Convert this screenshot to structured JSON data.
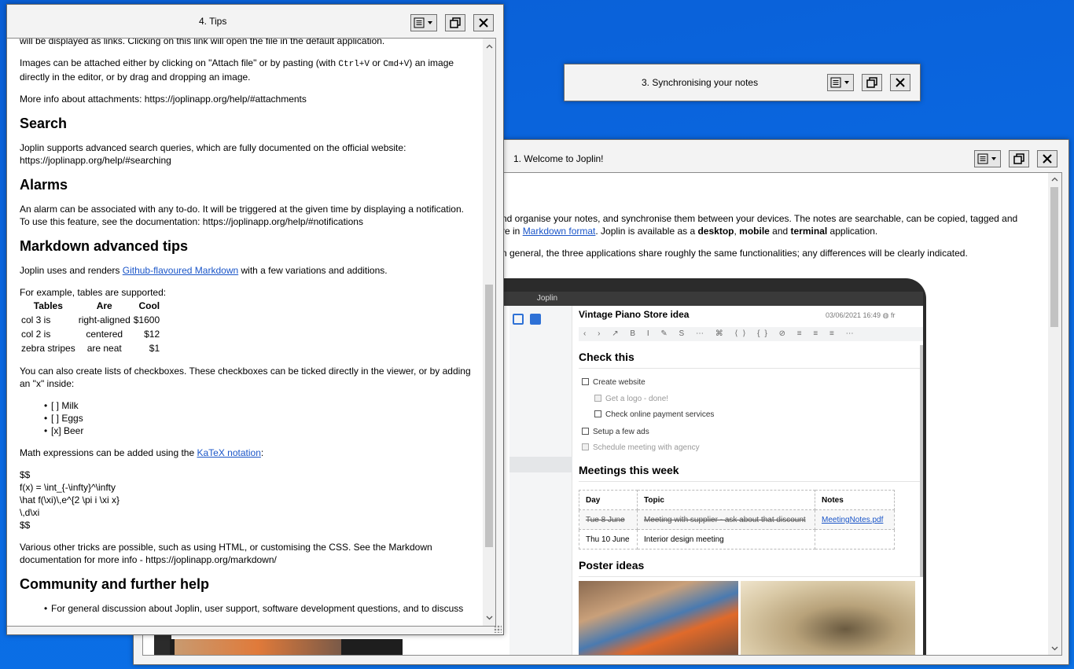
{
  "colors": {
    "desktop": "#0a67e0",
    "link": "#1a55c8",
    "window": "#f3f3f3"
  },
  "windows": {
    "tips": {
      "title": "4. Tips"
    },
    "sync": {
      "title": "3. Synchronising your notes"
    },
    "welcome": {
      "title": "1. Welcome to Joplin!"
    }
  },
  "tips": {
    "p_top": "will be displayed as links. Clicking on this link will open the file in the default application.",
    "p_images_1": "Images can be attached either by clicking on \"Attach file\" or by pasting (with ",
    "p_images_code1": "Ctrl+V",
    "p_images_or": " or ",
    "p_images_code2": "Cmd+V",
    "p_images_2": ") an image directly in the editor, or by drag and dropping an image.",
    "p_attach_info": "More info about attachments: https://joplinapp.org/help/#attachments",
    "h_search": "Search",
    "p_search": "Joplin supports advanced search queries, which are fully documented on the official website: https://joplinapp.org/help/#searching",
    "h_alarms": "Alarms",
    "p_alarms": "An alarm can be associated with any to-do. It will be triggered at the given time by displaying a notification. To use this feature, see the documentation: https://joplinapp.org/help/#notifications",
    "h_markdown": "Markdown advanced tips",
    "p_md_1": "Joplin uses and renders ",
    "p_md_link": "Github-flavoured Markdown",
    "p_md_2": " with a few variations and additions.",
    "p_tables": "For example, tables are supported:",
    "table": {
      "headers": [
        "Tables",
        "Are",
        "Cool"
      ],
      "rows": [
        [
          "col 3 is",
          "right-aligned",
          "$1600"
        ],
        [
          "col 2 is",
          "centered",
          "$12"
        ],
        [
          "zebra stripes",
          "are neat",
          "$1"
        ]
      ]
    },
    "p_checkbox": "You can also create lists of checkboxes. These checkboxes can be ticked directly in the viewer, or by adding an \"x\" inside:",
    "checklist": [
      "[ ] Milk",
      "[ ] Eggs",
      "[x] Beer"
    ],
    "p_math_1": "Math expressions can be added using the ",
    "p_math_link": "KaTeX notation",
    "p_math_2": ":",
    "math_lines": [
      "$$",
      "f(x) = \\int_{-\\infty}^\\infty",
      "\\hat f(\\xi)\\,e^{2 \\pi i \\xi x}",
      "\\,d\\xi",
      "$$"
    ],
    "p_tricks": "Various other tricks are possible, such as using HTML, or customising the CSS. See the Markdown documentation for more info - https://joplinapp.org/markdown/",
    "h_community": "Community and further help",
    "p_cut": "For general discussion about Joplin, user support, software development questions, and to discuss"
  },
  "welcome": {
    "line1": "nd organise your notes, and synchronise them between your devices. The notes are searchable, can be copied, tagged and",
    "line2_a": "re in ",
    "line2_link": "Markdown format",
    "line2_b": ". Joplin is available as a ",
    "line2_desktop": "desktop",
    "line2_comma": ", ",
    "line2_mobile": "mobile",
    "line2_and": " and ",
    "line2_terminal": "terminal",
    "line2_c": " application.",
    "line3": "n general, the three applications share roughly the same functionalities; any differences will be clearly indicated."
  },
  "app_screenshot": {
    "app_name": "Joplin",
    "note_title": "Vintage Piano Store idea",
    "date": "03/06/2021 16:49",
    "lang": "fr",
    "h_check": "Check this",
    "checks": [
      {
        "label": "Create website",
        "done": false,
        "indent": false
      },
      {
        "label": "Get a logo - done!",
        "done": true,
        "indent": true
      },
      {
        "label": "Check online payment services",
        "done": false,
        "indent": true
      },
      {
        "label": "Setup a few ads",
        "done": false,
        "indent": false
      },
      {
        "label": "Schedule meeting with agency",
        "done": true,
        "indent": false
      }
    ],
    "h_meetings": "Meetings this week",
    "meet_headers": [
      "Day",
      "Topic",
      "Notes"
    ],
    "meet_rows": [
      [
        "Tue 8 June",
        "Meeting with supplier - ask about that discount",
        "MeetingNotes.pdf"
      ],
      [
        "Thu 10 June",
        "Interior design meeting",
        ""
      ]
    ],
    "h_poster": "Poster ideas"
  }
}
